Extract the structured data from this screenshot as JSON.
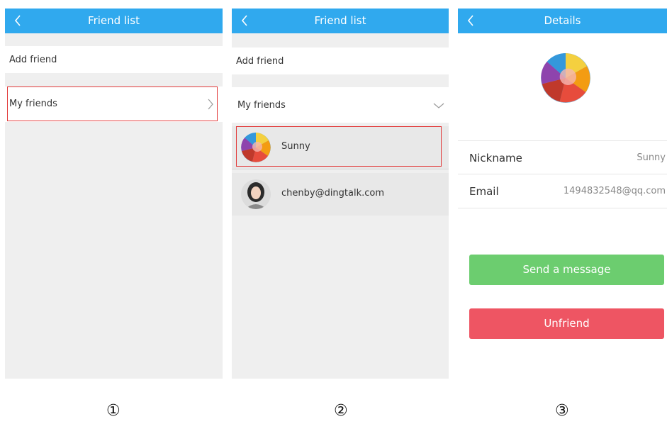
{
  "panel1": {
    "navbar": {
      "title": "Friend list",
      "back_icon": "chevron-left-icon"
    },
    "add_friend_label": "Add friend",
    "my_friends_label": "My friends",
    "my_friends_icon": "chevron-right-icon"
  },
  "panel2": {
    "navbar": {
      "title": "Friend list",
      "back_icon": "chevron-left-icon"
    },
    "add_friend_label": "Add friend",
    "my_friends_label": "My friends",
    "my_friends_icon": "chevron-down-icon",
    "friends": [
      {
        "name": "Sunny",
        "avatar": "rainbow-avatar"
      },
      {
        "name": "chenby@dingtalk.com",
        "avatar": "photo-avatar"
      }
    ]
  },
  "panel3": {
    "navbar": {
      "title": "Details",
      "back_icon": "chevron-left-icon"
    },
    "avatar": "rainbow-avatar",
    "fields": [
      {
        "key": "Nickname",
        "value": "Sunny"
      },
      {
        "key": "Email",
        "value": "1494832548@qq.com"
      }
    ],
    "send_button_label": "Send a message",
    "unfriend_button_label": "Unfriend"
  },
  "steps": [
    "①",
    "②",
    "③"
  ],
  "colors": {
    "navbar": "#30a9ee",
    "highlight_box": "#e23a3a",
    "send_button": "#6ccd6f",
    "unfriend_button": "#ee5563",
    "list_background": "#efefef"
  }
}
